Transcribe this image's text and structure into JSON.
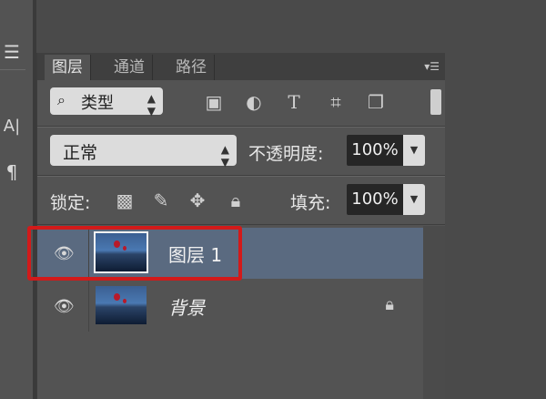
{
  "colors": {
    "accent_selection": "#5a6a80",
    "highlight_red": "#d21a1a"
  },
  "tool_strip": {
    "icon1": "sliders-icon",
    "text_icon_label": "A|",
    "icon3": "paragraph-icon"
  },
  "tabs": [
    {
      "label": "图层",
      "active": true
    },
    {
      "label": "通道",
      "active": false
    },
    {
      "label": "路径",
      "active": false
    }
  ],
  "filter": {
    "kind_label": "类型",
    "icons": [
      "image-filter-icon",
      "adjustment-filter-icon",
      "text-filter-icon",
      "shape-filter-icon",
      "smartobject-filter-icon"
    ],
    "text_icon_glyph": "T"
  },
  "blend_mode": {
    "value": "正常"
  },
  "opacity": {
    "label": "不透明度:",
    "value": "100%"
  },
  "lock": {
    "label": "锁定:",
    "icons": [
      "lock-transparent-icon",
      "lock-paint-icon",
      "lock-move-icon",
      "lock-all-icon"
    ]
  },
  "fill": {
    "label": "填充:",
    "value": "100%"
  },
  "layers": [
    {
      "name": "图层 1",
      "selected": true,
      "visible": true,
      "locked": false
    },
    {
      "name": "背景",
      "selected": false,
      "visible": true,
      "locked": true
    }
  ]
}
